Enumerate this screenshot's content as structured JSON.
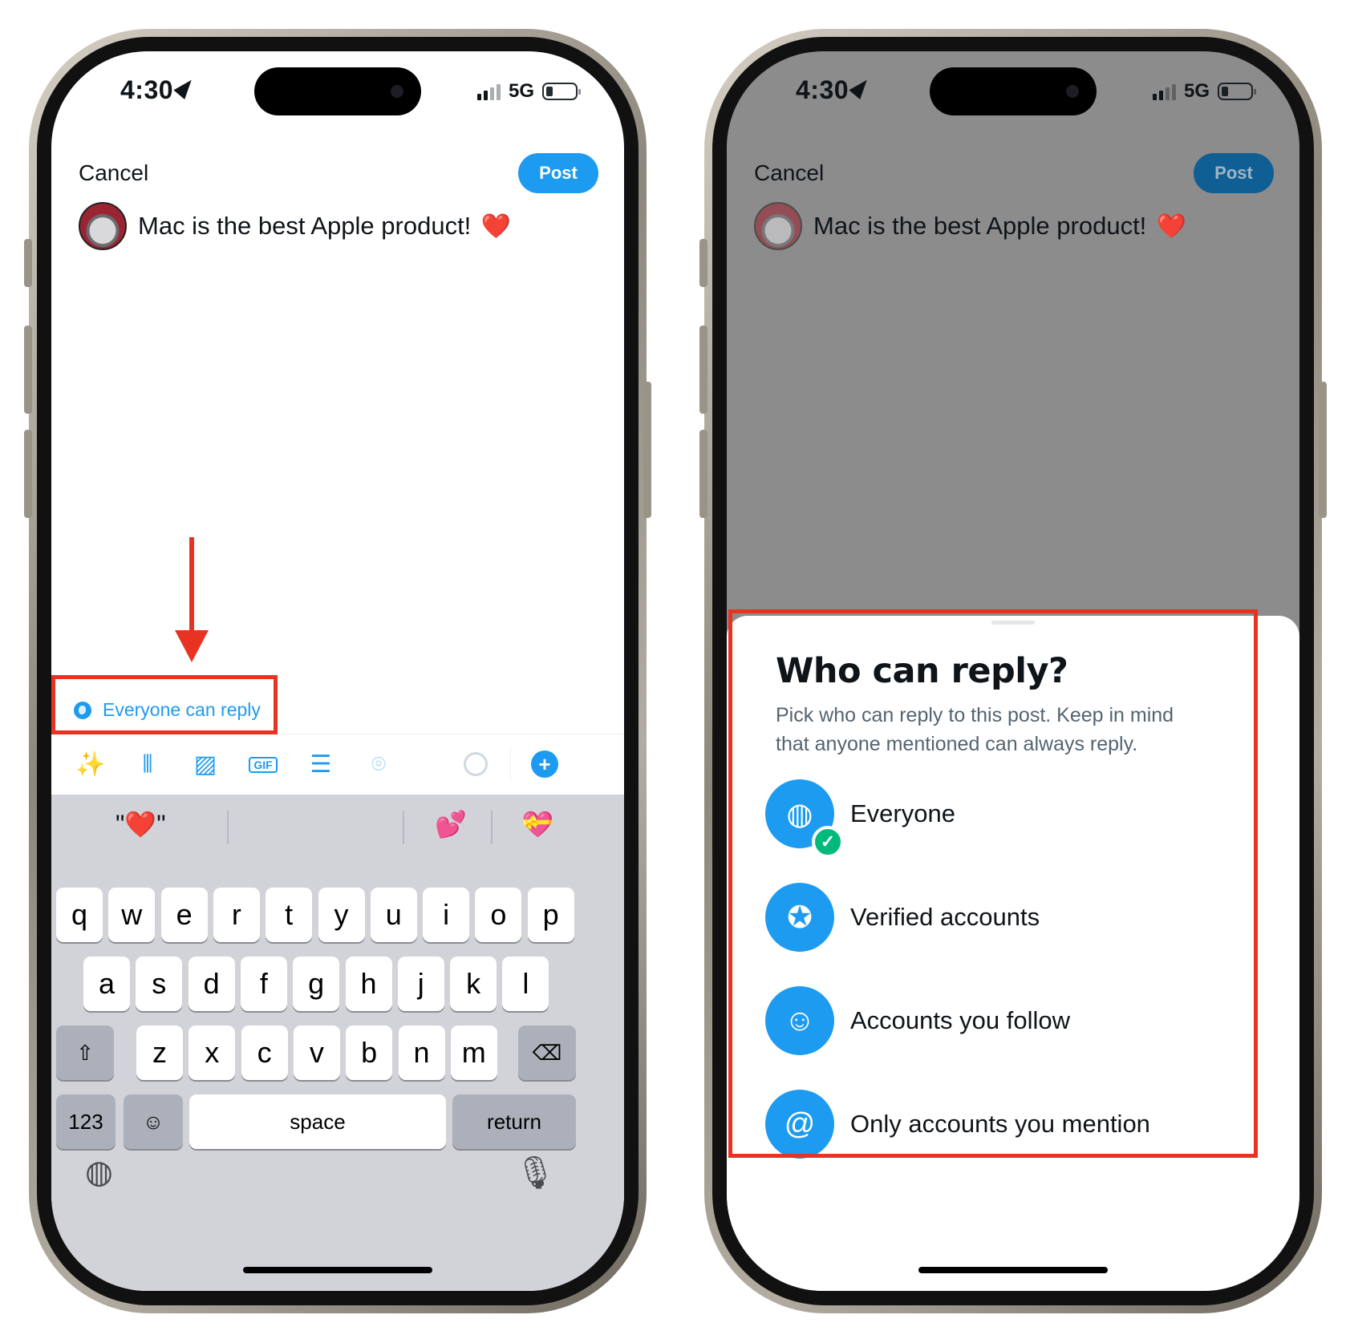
{
  "status_bar": {
    "time": "4:30",
    "network": "5G"
  },
  "compose": {
    "cancel_label": "Cancel",
    "post_label": "Post",
    "text": "Mac is the best Apple product!",
    "emoji": "❤️"
  },
  "reply_setting": {
    "label": "Everyone can reply",
    "icon": "globe-icon"
  },
  "toolbar": {
    "icons": [
      "grok-icon",
      "voice-icon",
      "image-icon",
      "gif-icon",
      "poll-icon",
      "location-icon",
      "progress-ring-icon",
      "add-icon"
    ]
  },
  "keyboard": {
    "suggestions": [
      "\"❤️\"",
      "💕",
      "💝"
    ],
    "row1": [
      "q",
      "w",
      "e",
      "r",
      "t",
      "y",
      "u",
      "i",
      "o",
      "p"
    ],
    "row2": [
      "a",
      "s",
      "d",
      "f",
      "g",
      "h",
      "j",
      "k",
      "l"
    ],
    "row3": [
      "z",
      "x",
      "c",
      "v",
      "b",
      "n",
      "m"
    ],
    "numbers_label": "123",
    "space_label": "space",
    "return_label": "return"
  },
  "reply_sheet": {
    "title": "Who can reply?",
    "description": "Pick who can reply to this post. Keep in mind that anyone mentioned can always reply.",
    "options": [
      {
        "label": "Everyone",
        "icon": "globe-icon",
        "selected": true
      },
      {
        "label": "Verified accounts",
        "icon": "verified-badge-icon",
        "selected": false
      },
      {
        "label": "Accounts you follow",
        "icon": "person-check-icon",
        "selected": false
      },
      {
        "label": "Only accounts you mention",
        "icon": "at-sign-icon",
        "selected": false
      }
    ]
  },
  "colors": {
    "accent": "#1d9bf0",
    "highlight": "#e83323",
    "success": "#00ba7c"
  }
}
